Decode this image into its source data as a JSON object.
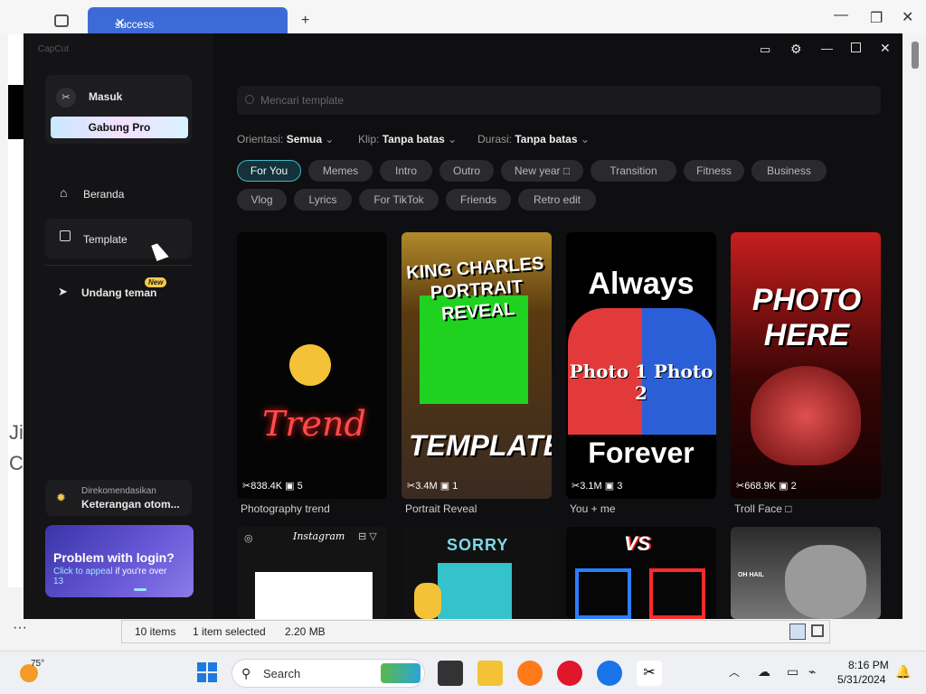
{
  "browser": {
    "tab_title": "success"
  },
  "explorer": {
    "status_items": "10 items",
    "status_selected": "1 item selected",
    "status_size": "2.20 MB"
  },
  "capcut": {
    "logo": "CapCut",
    "sidebar": {
      "login_label": "Masuk",
      "pro_label": "Gabung Pro",
      "nav": [
        {
          "label": "Beranda"
        },
        {
          "label": "Template"
        },
        {
          "label": "Undang teman"
        }
      ],
      "new_badge": "New",
      "rec_small": "Direkomendasikan",
      "rec_big": "Keterangan otom...",
      "promo_title": "Problem with login?",
      "promo_link": "Click to appeal",
      "promo_rest": " if you're over",
      "promo_num": "13"
    },
    "search_placeholder": "Mencari template",
    "filters": [
      {
        "key": "Orientasi:",
        "val": "Semua"
      },
      {
        "key": "Klip:",
        "val": "Tanpa batas"
      },
      {
        "key": "Durasi:",
        "val": "Tanpa batas"
      }
    ],
    "chips_row1": [
      "For You",
      "Memes",
      "Intro",
      "Outro",
      "New year □",
      "Transition",
      "Fitness",
      "Business"
    ],
    "chips_row2": [
      "Vlog",
      "Lyrics",
      "For TikTok",
      "Friends",
      "Retro edit"
    ],
    "templates": [
      {
        "name": "Photography trend",
        "uses": "838.4K",
        "clips": "5",
        "art": "Trend"
      },
      {
        "name": "Portrait Reveal",
        "uses": "3.4M",
        "clips": "1",
        "art_top": "KING CHARLES PORTRAIT REVEAL",
        "art_bottom": "TEMPLATE"
      },
      {
        "name": "You + me",
        "uses": "3.1M",
        "clips": "3",
        "art_top": "Always",
        "art_mid": "Photo 1 Photo 2",
        "art_bottom": "Forever"
      },
      {
        "name": "Troll Face □",
        "uses": "668.9K",
        "clips": "2",
        "art": "PHOTO HERE"
      }
    ],
    "row2": [
      {
        "art": "Instagram"
      },
      {
        "art": "SORRY"
      },
      {
        "art": "VS"
      },
      {
        "art": "OH HAIL"
      }
    ]
  },
  "taskbar": {
    "weather": "75°",
    "search": "Search",
    "time": "8:16 PM",
    "date": "5/31/2024"
  }
}
